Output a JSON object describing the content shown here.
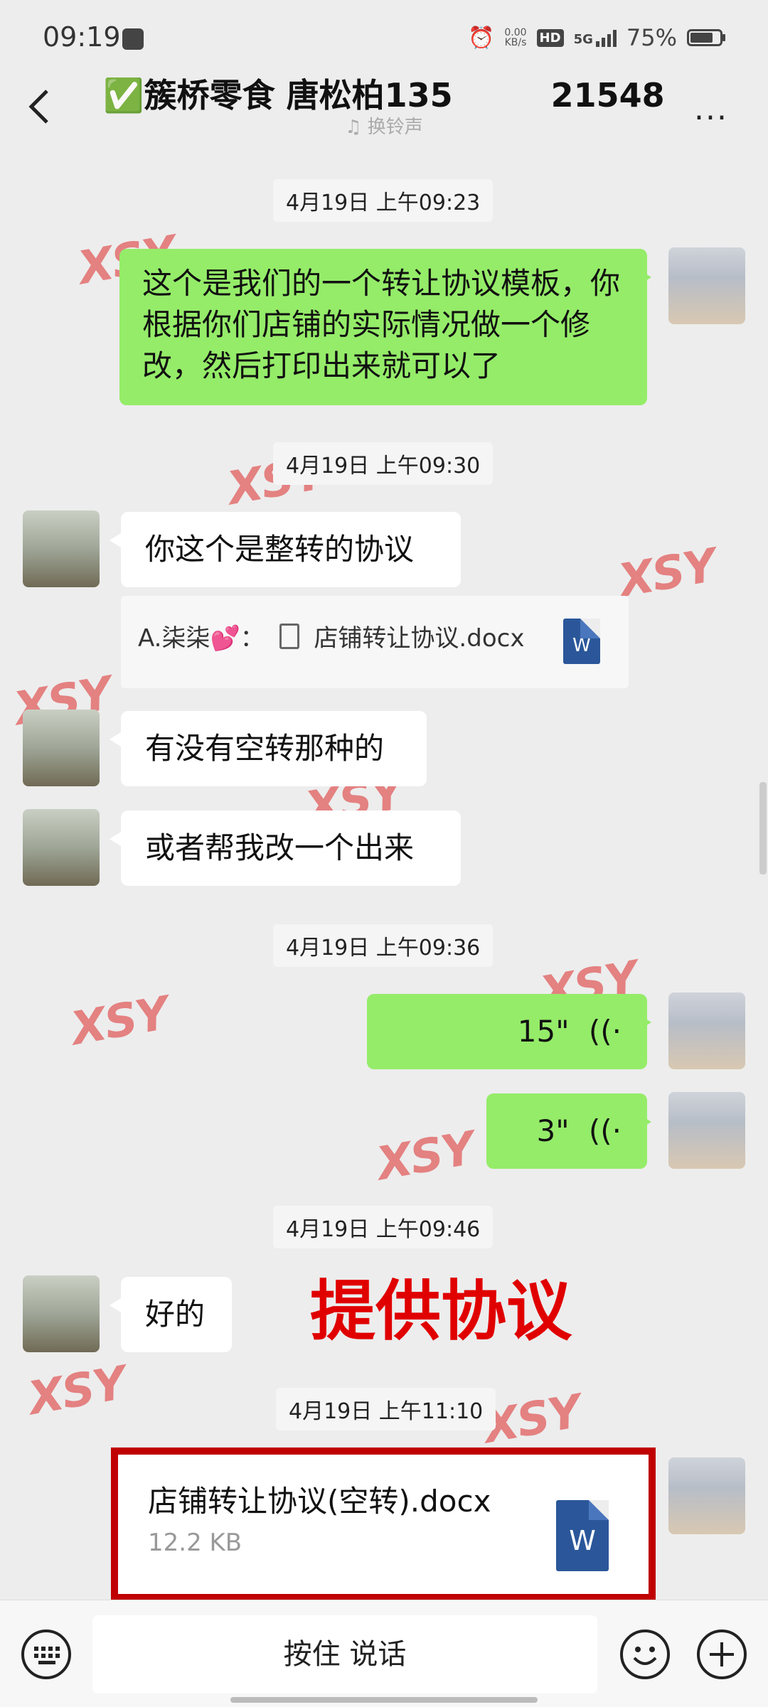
{
  "status": {
    "time": "09:19",
    "net_speed_top": "0.00",
    "net_speed_unit": "KB/s",
    "hd": "HD",
    "network": "5G",
    "battery": "75%"
  },
  "header": {
    "title": "✅簇桥零食 唐松柏135　　　21548",
    "subtitle": "换铃声",
    "more": "..."
  },
  "messages": {
    "t1": "4月19日 上午09:23",
    "m1": "这个是我们的一个转让协议模板，你根据你们店铺的实际情况做一个修改，然后打印出来就可以了",
    "t2": "4月19日 上午09:30",
    "m2": "你这个是整转的协议",
    "quote_sender": "A.柒柒💕：",
    "quote_file": "店铺转让协议.docx",
    "m3": "有没有空转那种的",
    "m4": "或者帮我改一个出来",
    "t3": "4月19日 上午09:36",
    "voice1": "15\"",
    "voice2": "3\"",
    "t4": "4月19日 上午09:46",
    "m5": "好的",
    "t5": "4月19日 上午11:10",
    "file_name": "店铺转让协议(空转).docx",
    "file_size": "12.2 KB",
    "word_letter": "W"
  },
  "overlay": {
    "label": "提供协议",
    "watermark": "XSY"
  },
  "bottom": {
    "talk": "按住 说话"
  },
  "colors": {
    "green_bubble": "#95ec69",
    "highlight_red": "#c00000",
    "word_blue": "#2b579a"
  }
}
